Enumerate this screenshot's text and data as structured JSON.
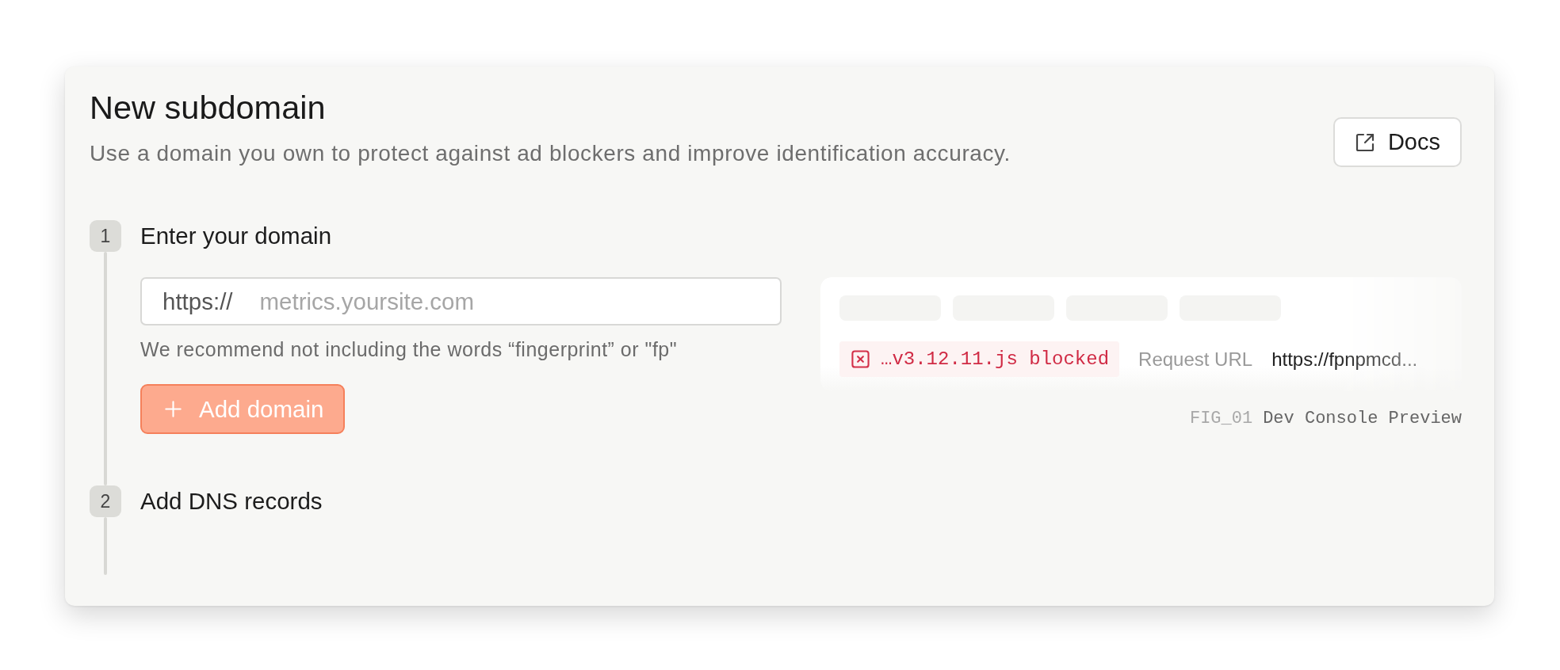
{
  "header": {
    "title": "New subdomain",
    "subtitle": "Use a domain you own to protect against ad blockers and improve identification accuracy.",
    "docs_button": "Docs"
  },
  "steps": [
    {
      "number": "1",
      "title": "Enter your domain",
      "kind": "form",
      "field": {
        "prefix": "https://",
        "placeholder": "metrics.yoursite.com"
      },
      "hint": "We recommend not including the words “fingerprint” or \"fp\"",
      "button": {
        "label": "Add domain",
        "disabled": true
      },
      "preview": {
        "blocked": "…v3.12.11.js blocked",
        "label": "Request URL",
        "url": "https://fpnpmcd...",
        "caption": {
          "number": "FIG_01",
          "title": "Dev Console Preview"
        }
      }
    },
    {
      "number": "2",
      "title": "Add DNS records",
      "kind": "heading"
    }
  ]
}
